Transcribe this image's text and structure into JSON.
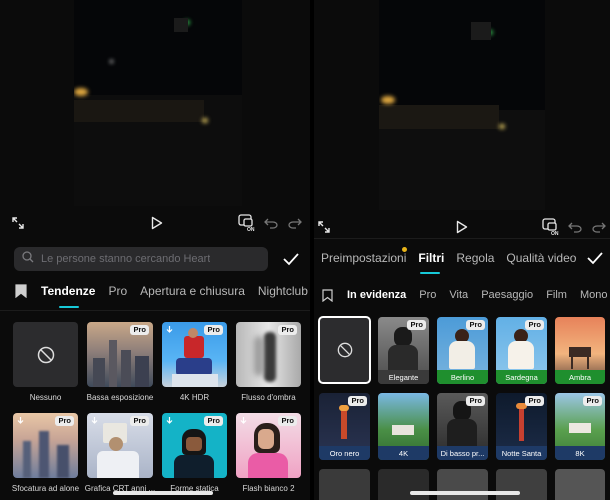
{
  "left": {
    "search": {
      "placeholder": "Le persone stanno cercando Heart"
    },
    "tabs": [
      {
        "label": "Tendenze",
        "active": true
      },
      {
        "label": "Pro",
        "active": false
      },
      {
        "label": "Apertura e chiusura",
        "active": false
      },
      {
        "label": "Nightclub",
        "active": false
      }
    ],
    "effects": [
      {
        "label": "Nessuno",
        "pro": false
      },
      {
        "label": "Bassa esposizione",
        "pro": true,
        "badge": "Pro"
      },
      {
        "label": "4K HDR",
        "pro": true,
        "badge": "Pro"
      },
      {
        "label": "Flusso d'ombra",
        "pro": true,
        "badge": "Pro"
      },
      {
        "label": "Sfocatura ad alone",
        "pro": true,
        "badge": "Pro"
      },
      {
        "label": "Grafica CRT anni ...",
        "pro": true,
        "badge": "Pro"
      },
      {
        "label": "Forme statica",
        "pro": true,
        "badge": "Pro"
      },
      {
        "label": "Flash bianco 2",
        "pro": true,
        "badge": "Pro"
      }
    ]
  },
  "right": {
    "main_tabs": [
      {
        "label": "Preimpostazioni",
        "active": false,
        "has_dot": true
      },
      {
        "label": "Filtri",
        "active": true
      },
      {
        "label": "Regola",
        "active": false
      },
      {
        "label": "Qualità video",
        "active": false
      }
    ],
    "sub_tabs": [
      {
        "label": "In evidenza",
        "active": true
      },
      {
        "label": "Pro",
        "active": false
      },
      {
        "label": "Vita",
        "active": false
      },
      {
        "label": "Paesaggio",
        "active": false
      },
      {
        "label": "Film",
        "active": false
      },
      {
        "label": "Mono",
        "active": false
      }
    ],
    "filters": [
      {
        "label": "",
        "pro": false
      },
      {
        "label": "Elegante",
        "badge": "Pro",
        "strip_color": "#3a3a3a"
      },
      {
        "label": "Berlino",
        "badge": "Pro",
        "strip_color": "#1f8f2e"
      },
      {
        "label": "Sardegna",
        "badge": "Pro",
        "strip_color": "#1f8f2e"
      },
      {
        "label": "Ambra",
        "badge": "",
        "strip_color": "#1f8f2e"
      },
      {
        "label": "Oro nero",
        "badge": "Pro",
        "strip_color": "#1e3a66"
      },
      {
        "label": "4K",
        "badge": "",
        "strip_color": "#1e3a66"
      },
      {
        "label": "Di basso pr...",
        "badge": "Pro",
        "strip_color": "#1e3a66"
      },
      {
        "label": "Notte Santa",
        "badge": "Pro",
        "strip_color": "#1e3a66"
      },
      {
        "label": "8K",
        "badge": "Pro",
        "strip_color": "#1e3a66"
      }
    ]
  },
  "colors": {
    "accent": "#17c9d8",
    "pro_badge_bg": "#ececec",
    "dot": "#e8b419"
  },
  "icons": [
    "expand-icon",
    "play-icon",
    "caption-on-icon",
    "undo-icon",
    "redo-icon",
    "search-icon",
    "checkmark-icon",
    "bookmark-icon",
    "no-effect-icon",
    "download-icon"
  ]
}
